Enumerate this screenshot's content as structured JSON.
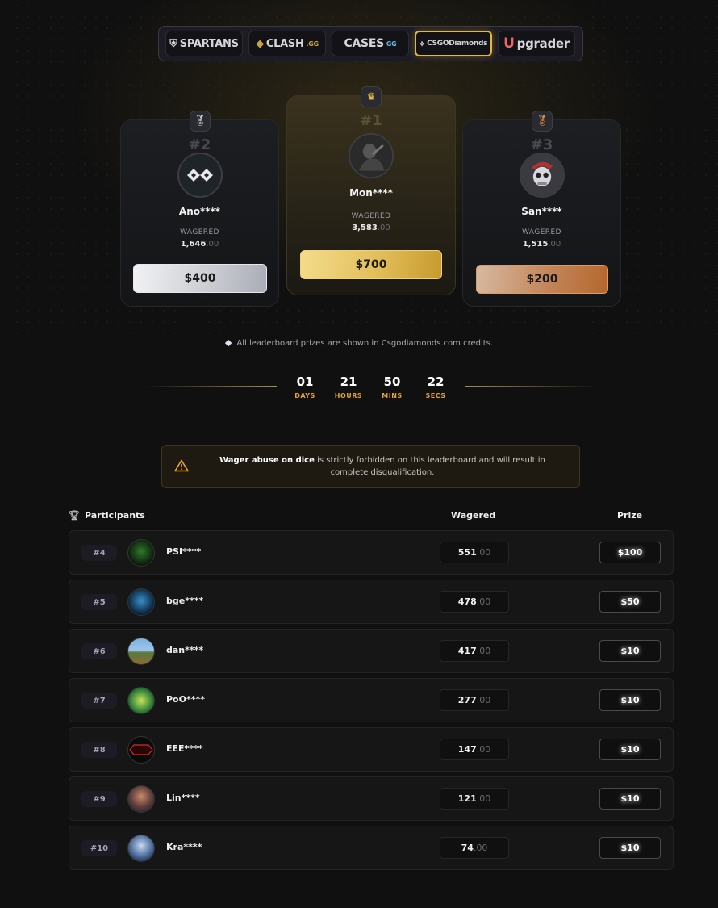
{
  "sites": [
    {
      "label": "SPARTANS",
      "suffix": ""
    },
    {
      "label": "CLASH",
      "suffix": ".GG"
    },
    {
      "label": "CASES",
      "suffix": "GG"
    },
    {
      "label": "CSGODiamonds",
      "suffix": ""
    },
    {
      "label": "pgrader",
      "prefix": "U"
    }
  ],
  "podium": {
    "first": {
      "rank": "#1",
      "name": "Mon****",
      "wagered_label": "WAGERED",
      "wagered": "3,583",
      "decimals": ".00",
      "prize": "$700"
    },
    "second": {
      "rank": "#2",
      "name": "Ano****",
      "wagered_label": "WAGERED",
      "wagered": "1,646",
      "decimals": ".00",
      "prize": "$400"
    },
    "third": {
      "rank": "#3",
      "name": "San****",
      "wagered_label": "WAGERED",
      "wagered": "1,515",
      "decimals": ".00",
      "prize": "$200"
    }
  },
  "note": "All leaderboard prizes are shown in Csgodiamonds.com credits.",
  "countdown": [
    {
      "value": "01",
      "label": "DAYS"
    },
    {
      "value": "21",
      "label": "HOURS"
    },
    {
      "value": "50",
      "label": "MINS"
    },
    {
      "value": "22",
      "label": "SECS"
    }
  ],
  "warning": {
    "bold": "Wager abuse on dice",
    "rest": " is strictly forbidden on this leaderboard and will result in complete disqualification."
  },
  "table": {
    "col_participants": "Participants",
    "col_wagered": "Wagered",
    "col_prize": "Prize",
    "rows": [
      {
        "rank": "#4",
        "name": "PSI****",
        "wagered": "551",
        "dec": ".00",
        "prize": "$100"
      },
      {
        "rank": "#5",
        "name": "bge****",
        "wagered": "478",
        "dec": ".00",
        "prize": "$50"
      },
      {
        "rank": "#6",
        "name": "dan****",
        "wagered": "417",
        "dec": ".00",
        "prize": "$10"
      },
      {
        "rank": "#7",
        "name": "PoO****",
        "wagered": "277",
        "dec": ".00",
        "prize": "$10"
      },
      {
        "rank": "#8",
        "name": "EEE****",
        "wagered": "147",
        "dec": ".00",
        "prize": "$10"
      },
      {
        "rank": "#9",
        "name": "Lin****",
        "wagered": "121",
        "dec": ".00",
        "prize": "$10"
      },
      {
        "rank": "#10",
        "name": "Kra****",
        "wagered": "74",
        "dec": ".00",
        "prize": "$10"
      }
    ]
  }
}
